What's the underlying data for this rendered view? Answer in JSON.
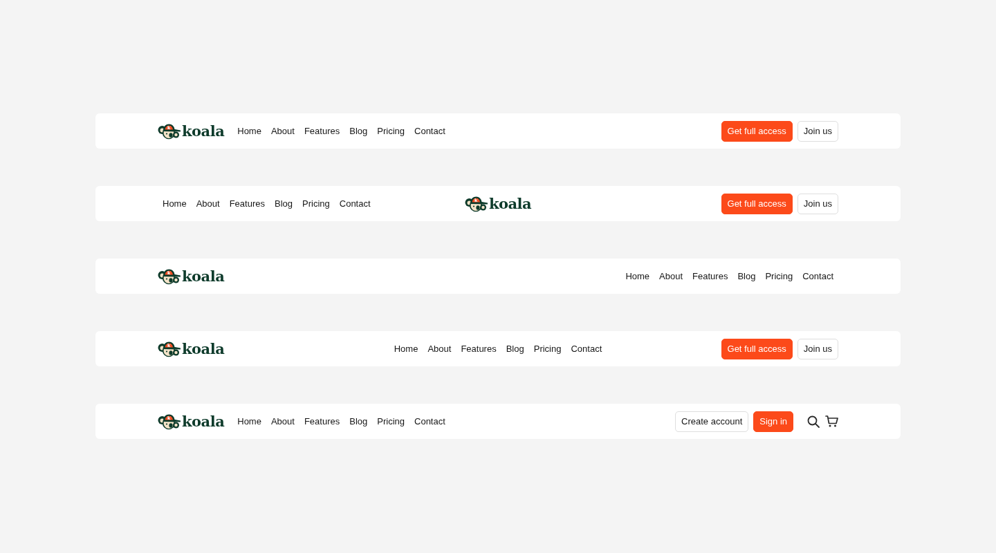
{
  "navbars": [
    {
      "kind": "classic",
      "logo": {
        "badge": "k",
        "wordmark": "koala"
      },
      "links": [
        "Home",
        "About",
        "Features",
        "Blog",
        "Pricing",
        "Contact"
      ],
      "buttons": [
        {
          "label": "Get full access",
          "kind": "primary"
        },
        {
          "label": "Join us",
          "kind": "secondary"
        }
      ]
    },
    {
      "kind": "centered",
      "logo": {
        "badge": "k",
        "wordmark": "koala"
      },
      "links": [
        "Home",
        "About",
        "Features",
        "Blog",
        "Pricing",
        "Contact"
      ],
      "buttons": [
        {
          "label": "Get full access",
          "kind": "primary"
        },
        {
          "label": "Join us",
          "kind": "secondary"
        }
      ]
    },
    {
      "kind": "simple",
      "logo": {
        "badge": "k",
        "wordmark": "koala"
      },
      "links": [
        "Home",
        "About",
        "Features",
        "Blog",
        "Pricing",
        "Contact"
      ]
    },
    {
      "kind": "split",
      "logo": {
        "badge": "k",
        "wordmark": "koala"
      },
      "links": [
        "Home",
        "About",
        "Features",
        "Blog",
        "Pricing",
        "Contact"
      ],
      "buttons": [
        {
          "label": "Get full access",
          "kind": "primary"
        },
        {
          "label": "Join us",
          "kind": "secondary"
        }
      ]
    },
    {
      "kind": "store",
      "logo": {
        "badge": "k",
        "wordmark": "koala"
      },
      "links": [
        "Home",
        "About",
        "Features",
        "Blog",
        "Pricing",
        "Contact"
      ],
      "buttons": [
        {
          "label": "Create account",
          "kind": "secondary"
        },
        {
          "label": "Sign in",
          "kind": "primary"
        }
      ]
    }
  ]
}
